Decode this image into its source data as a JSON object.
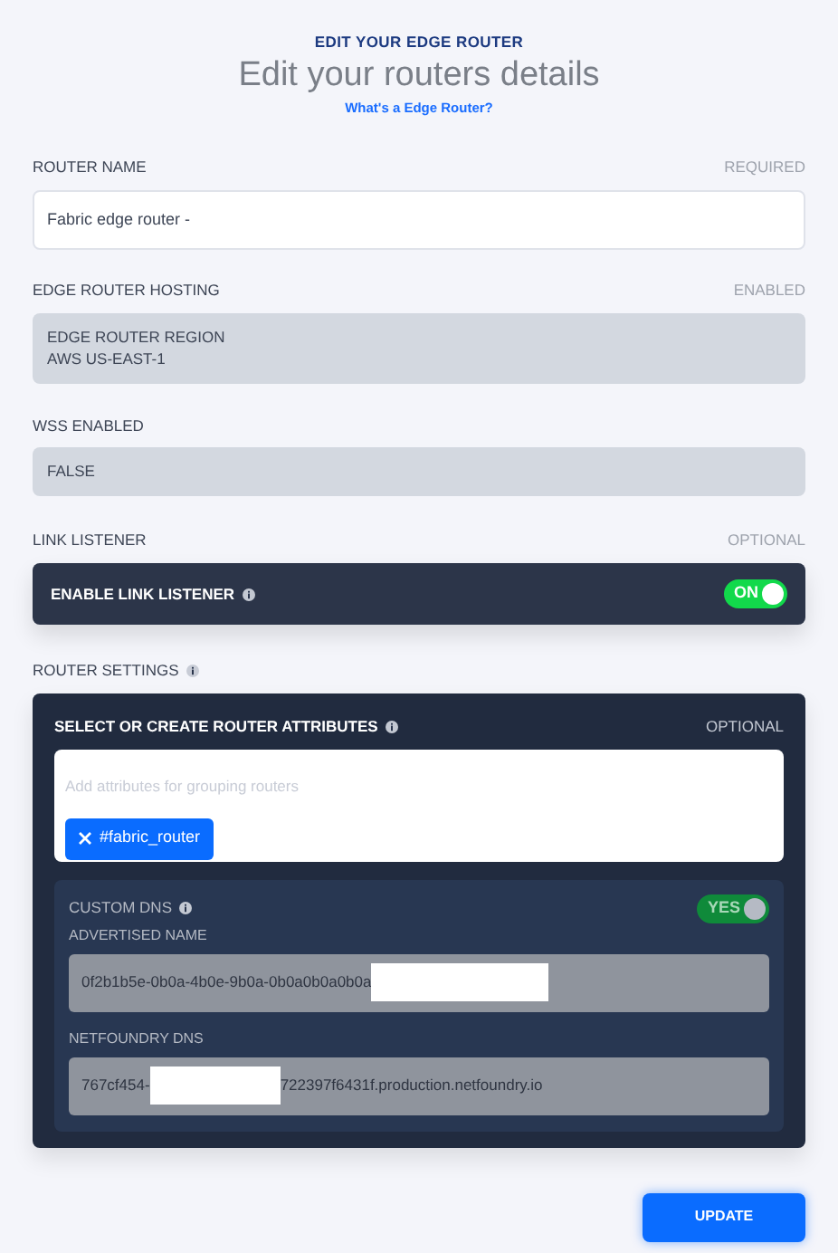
{
  "header": {
    "eyebrow": "EDIT YOUR EDGE ROUTER",
    "title": "Edit your routers details",
    "help_link": "What's a Edge Router?"
  },
  "router_name": {
    "label": "ROUTER NAME",
    "note": "REQUIRED",
    "value": "Fabric edge router -"
  },
  "hosting": {
    "label": "EDGE ROUTER HOSTING",
    "note": "ENABLED",
    "lines": [
      "EDGE ROUTER REGION",
      "AWS US-EAST-1"
    ]
  },
  "wss": {
    "label": "WSS ENABLED",
    "value": "FALSE"
  },
  "link_listener": {
    "label": "LINK LISTENER",
    "note": "OPTIONAL",
    "toggle_label": "ENABLE LINK LISTENER",
    "toggle": {
      "on": true,
      "text": "ON",
      "disabled": false
    }
  },
  "router_settings": {
    "label": "ROUTER SETTINGS",
    "attributes": {
      "label": "SELECT OR CREATE ROUTER ATTRIBUTES",
      "note": "OPTIONAL",
      "placeholder": "Add attributes for grouping routers",
      "tags": [
        "#fabric_router"
      ]
    },
    "custom_dns": {
      "label": "CUSTOM DNS",
      "toggle": {
        "on": true,
        "text": "YES",
        "disabled": true
      },
      "fields": [
        {
          "label": "ADVERTISED NAME",
          "value_start": "0f2b1b5e-0b0a-4b0e-9b0a-0b0a0b0a0b0a"
        },
        {
          "label": "NETFOUNDRY DNS",
          "value_start": "767cf454-",
          "value_end": "722397f6431f.production.netfoundry.io"
        }
      ]
    }
  },
  "update_button": "UPDATE"
}
